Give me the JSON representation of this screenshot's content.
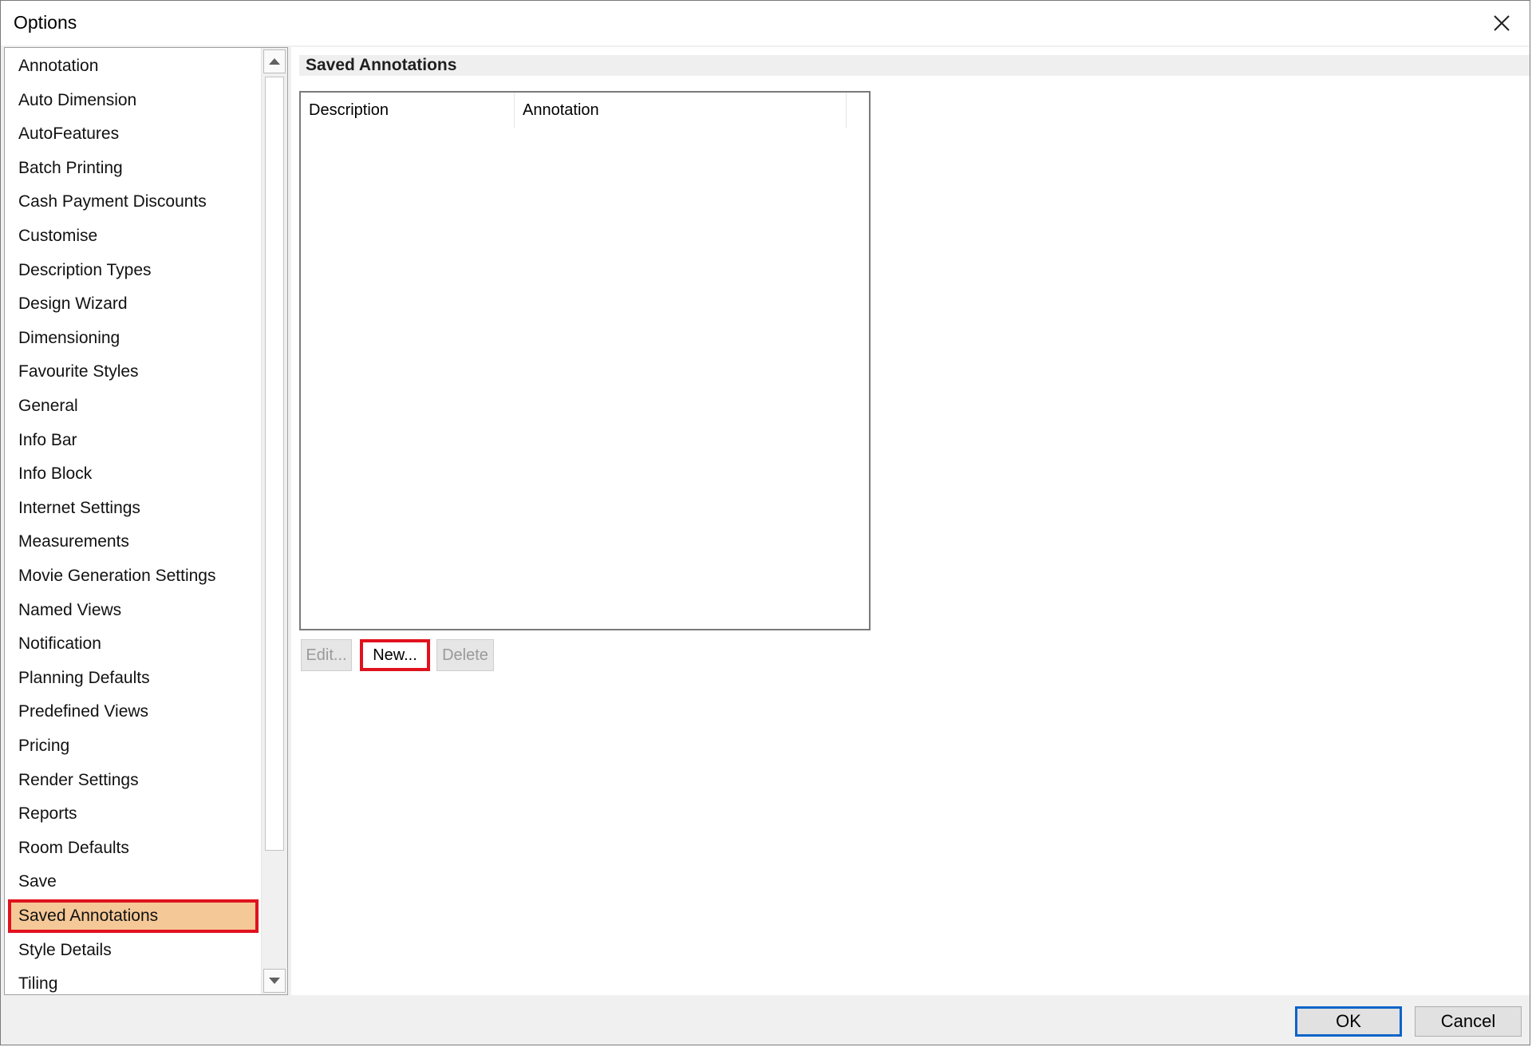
{
  "window": {
    "title": "Options"
  },
  "nav": {
    "items": [
      {
        "label": "Annotation"
      },
      {
        "label": "Auto Dimension"
      },
      {
        "label": "AutoFeatures"
      },
      {
        "label": "Batch Printing"
      },
      {
        "label": "Cash Payment Discounts"
      },
      {
        "label": "Customise"
      },
      {
        "label": "Description Types"
      },
      {
        "label": "Design Wizard"
      },
      {
        "label": "Dimensioning"
      },
      {
        "label": "Favourite Styles"
      },
      {
        "label": "General"
      },
      {
        "label": "Info Bar"
      },
      {
        "label": "Info Block"
      },
      {
        "label": "Internet Settings"
      },
      {
        "label": "Measurements"
      },
      {
        "label": "Movie Generation Settings"
      },
      {
        "label": "Named Views"
      },
      {
        "label": "Notification"
      },
      {
        "label": "Planning Defaults"
      },
      {
        "label": "Predefined Views"
      },
      {
        "label": "Pricing"
      },
      {
        "label": "Render Settings"
      },
      {
        "label": "Reports"
      },
      {
        "label": "Room Defaults"
      },
      {
        "label": "Save"
      },
      {
        "label": "Saved Annotations"
      },
      {
        "label": "Style Details"
      },
      {
        "label": "Tiling"
      }
    ],
    "selected_index": 25
  },
  "content": {
    "section_title": "Saved Annotations",
    "columns": [
      "Description",
      "Annotation"
    ],
    "rows": [],
    "buttons": {
      "edit": "Edit...",
      "new": "New...",
      "delete": "Delete"
    }
  },
  "footer": {
    "ok": "OK",
    "cancel": "Cancel"
  },
  "colors": {
    "selected_bg": "#f5c897",
    "highlight_border": "#e0121e",
    "ok_border": "#0a64c8"
  },
  "icons": {
    "close": "close-icon",
    "scroll_up": "arrow-up-icon",
    "scroll_down": "arrow-down-icon"
  }
}
